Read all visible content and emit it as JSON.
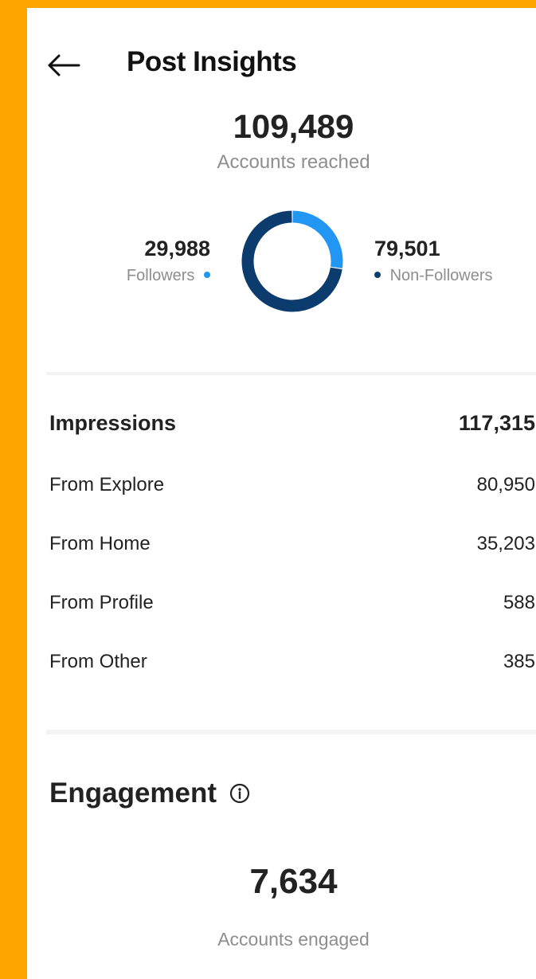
{
  "header": {
    "title": "Post Insights",
    "back_icon": "arrow-left-icon"
  },
  "reach": {
    "accounts_reached": "109,489",
    "accounts_reached_label": "Accounts reached",
    "followers_value": "29,988",
    "followers_label": "Followers",
    "non_followers_value": "79,501",
    "non_followers_label": "Non-Followers"
  },
  "chart_data": {
    "type": "pie",
    "categories": [
      "Followers",
      "Non-Followers"
    ],
    "values": [
      29988,
      79501
    ],
    "colors": [
      "#2196F3",
      "#0C3C6E"
    ]
  },
  "impressions": {
    "label": "Impressions",
    "value": "117,315",
    "rows": [
      {
        "label": "From Explore",
        "value": "80,950"
      },
      {
        "label": "From Home",
        "value": "35,203"
      },
      {
        "label": "From Profile",
        "value": "588"
      },
      {
        "label": "From Other",
        "value": "385"
      }
    ]
  },
  "engagement": {
    "title": "Engagement",
    "info_icon": "info-icon",
    "accounts_engaged": "7,634",
    "accounts_engaged_label": "Accounts engaged"
  },
  "colors": {
    "frame": "#FFA500",
    "followers": "#2196F3",
    "non_followers": "#0C3C6E",
    "muted_text": "#8e8e8e"
  }
}
